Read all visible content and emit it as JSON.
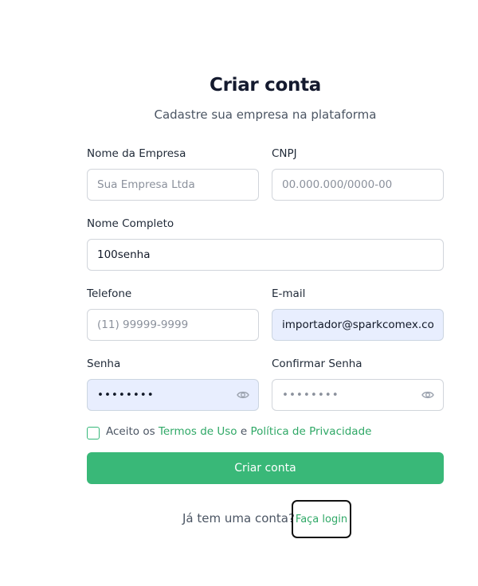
{
  "header": {
    "title": "Criar conta",
    "subtitle": "Cadastre sua empresa na plataforma"
  },
  "form": {
    "company_name": {
      "label": "Nome da Empresa",
      "placeholder": "Sua Empresa Ltda",
      "value": ""
    },
    "cnpj": {
      "label": "CNPJ",
      "placeholder": "00.000.000/0000-00",
      "value": ""
    },
    "full_name": {
      "label": "Nome Completo",
      "placeholder": "",
      "value": "100senha"
    },
    "phone": {
      "label": "Telefone",
      "placeholder": "(11) 99999-9999",
      "value": ""
    },
    "email": {
      "label": "E-mail",
      "placeholder": "",
      "value": "importador@sparkcomex.com"
    },
    "password": {
      "label": "Senha",
      "value": "••••••••",
      "toggle_icon": "eye-icon"
    },
    "confirm_password": {
      "label": "Confirmar Senha",
      "placeholder": "••••••••",
      "value": "",
      "toggle_icon": "eye-icon"
    },
    "terms": {
      "prefix": "Aceito os",
      "terms_link": "Termos de Uso",
      "conjunction": "e",
      "privacy_link": "Política de Privacidade",
      "checked": false
    },
    "submit_label": "Criar conta"
  },
  "footer": {
    "question": "Já tem uma conta?",
    "login_link": "Faça login"
  },
  "colors": {
    "accent": "#39b878",
    "link": "#2fa866",
    "autofill_bg": "#e8eefe"
  }
}
